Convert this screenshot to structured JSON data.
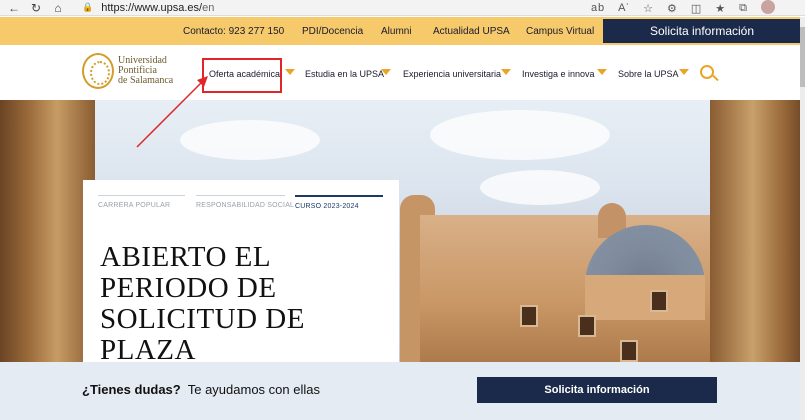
{
  "browser": {
    "url_domain": "https://www.upsa.es/",
    "url_path": "en",
    "icons": [
      "back-icon",
      "refresh-icon",
      "home-icon",
      "lock-icon",
      "reading-icon",
      "read-aloud-icon",
      "favorite-icon",
      "extensions-icon",
      "split-screen-icon",
      "favorites-icon",
      "collections-icon",
      "profile-avatar"
    ]
  },
  "topbar": {
    "contact": "Contacto: 923 277 150",
    "links": [
      "PDI/Docencia",
      "Alumni",
      "Actualidad UPSA",
      "Campus Virtual"
    ],
    "cta": "Solicita información",
    "color": "#f6c96b",
    "cta_color": "#1b2a4a"
  },
  "logo": {
    "line1": "Universidad",
    "line2": "Pontificia",
    "line3": "de Salamanca"
  },
  "nav": {
    "items": [
      "Oferta académica",
      "Estudia en la UPSA",
      "Experiencia universitaria",
      "Investiga e innova",
      "Sobre la UPSA"
    ],
    "accent": "#e9a524",
    "highlight_color": "#e1262a"
  },
  "hero": {
    "tabs": [
      "CARRERA POPULAR",
      "RESPONSABILIDAD SOCIAL",
      "CURSO 2023-2024"
    ],
    "active_tab": "CURSO 2023-2024",
    "title": "ABIERTO EL PERIODO DE SOLICITUD DE PLAZA"
  },
  "bottom": {
    "question_bold": "¿Tienes dudas?",
    "question_rest": "Te ayudamos con ellas",
    "cta": "Solicita información"
  }
}
